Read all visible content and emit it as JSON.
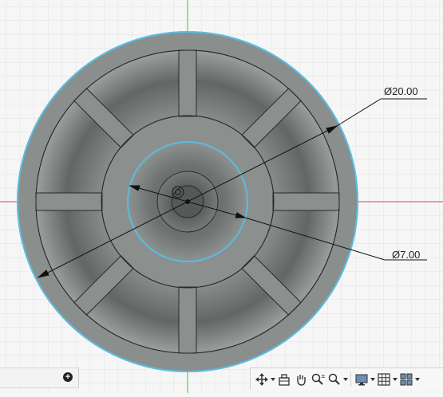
{
  "viewport": {
    "dimensions": {
      "large_diameter": "Ø20.00",
      "small_diameter": "Ø7.00"
    },
    "colors": {
      "background": "#f6f6f6",
      "grid": "#d6d6d6",
      "x_axis": "#e04040",
      "y_axis": "#40c040",
      "edge_highlight": "#5bbce0",
      "body_fill": "#8a8d8c",
      "recess_fill": "#6f7372"
    }
  },
  "timeline": {
    "add_label": "+"
  },
  "navigation_toolbar": {
    "icons": [
      "orbit-icon",
      "fit-icon",
      "pan-icon",
      "zoom-icon",
      "zoom-window-icon",
      "display-settings-icon",
      "grid-settings-icon",
      "viewports-icon"
    ]
  }
}
